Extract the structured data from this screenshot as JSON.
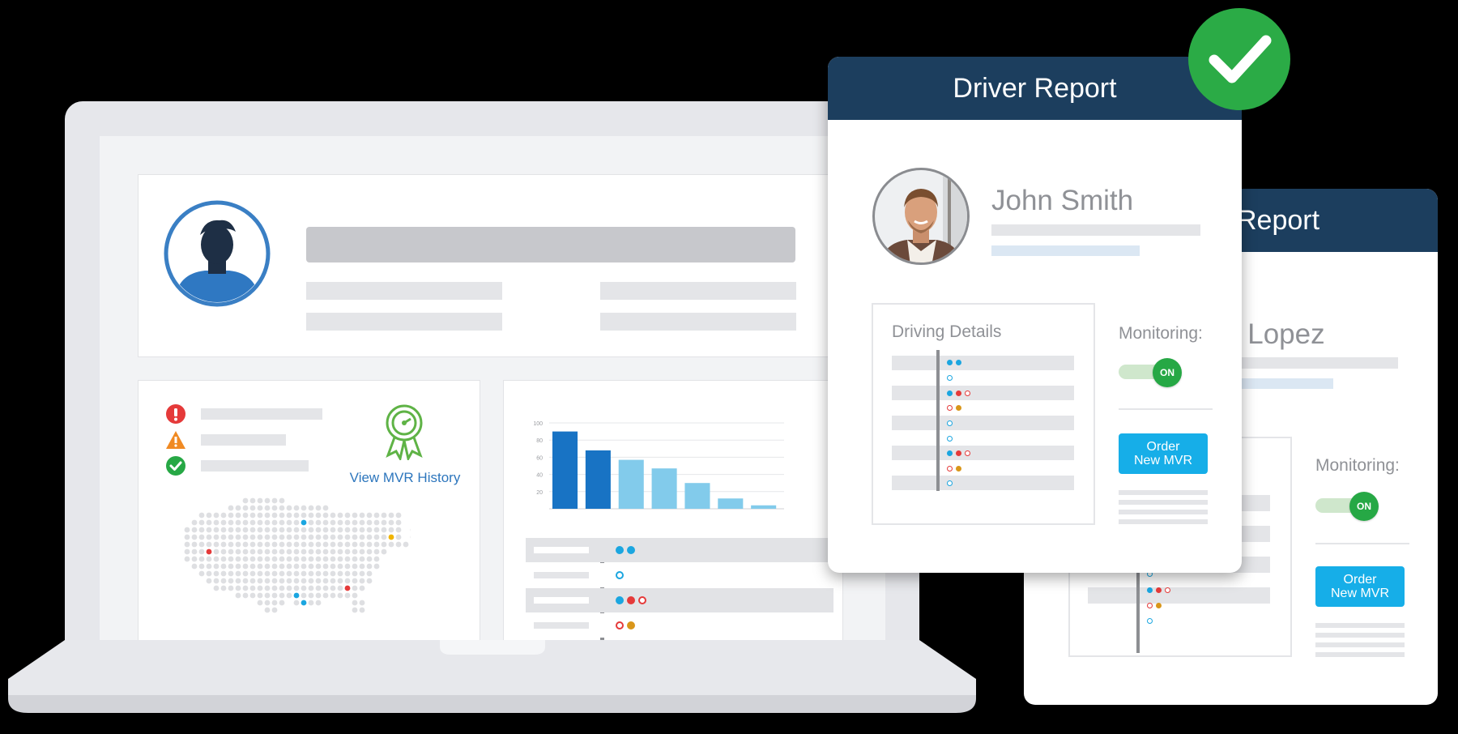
{
  "laptop": {
    "mvr_link": "View MVR History",
    "chart_data": {
      "type": "bar",
      "ytick_labels": [
        "100",
        "80",
        "60",
        "40",
        "20"
      ],
      "values": [
        90,
        68,
        57,
        47,
        30,
        12,
        4
      ],
      "colors": [
        "#1873c4",
        "#1873c4",
        "#82cbeb",
        "#82cbeb",
        "#82cbeb",
        "#82cbeb",
        "#82cbeb"
      ],
      "ylim": [
        0,
        100
      ],
      "grid": true
    },
    "colors": {
      "blue": "#1873c4",
      "light_blue": "#82cbeb",
      "alert_red": "#e53a3a",
      "warning_orange": "#f08a23",
      "ok_green": "#27a845"
    }
  },
  "front_report": {
    "title": "Driver Report",
    "name": "John Smith",
    "driving_details_label": "Driving Details",
    "monitoring_label": "Monitoring:",
    "toggle_label": "ON",
    "order_line1": "Order",
    "order_line2": "New MVR",
    "icon": "checkmark-badge-icon"
  },
  "back_report": {
    "title_fragment": "Report",
    "name_fragment": "k Lopez",
    "monitoring_label": "Monitoring:",
    "toggle_label": "ON",
    "order_line1": "Order",
    "order_line2": "New MVR"
  }
}
